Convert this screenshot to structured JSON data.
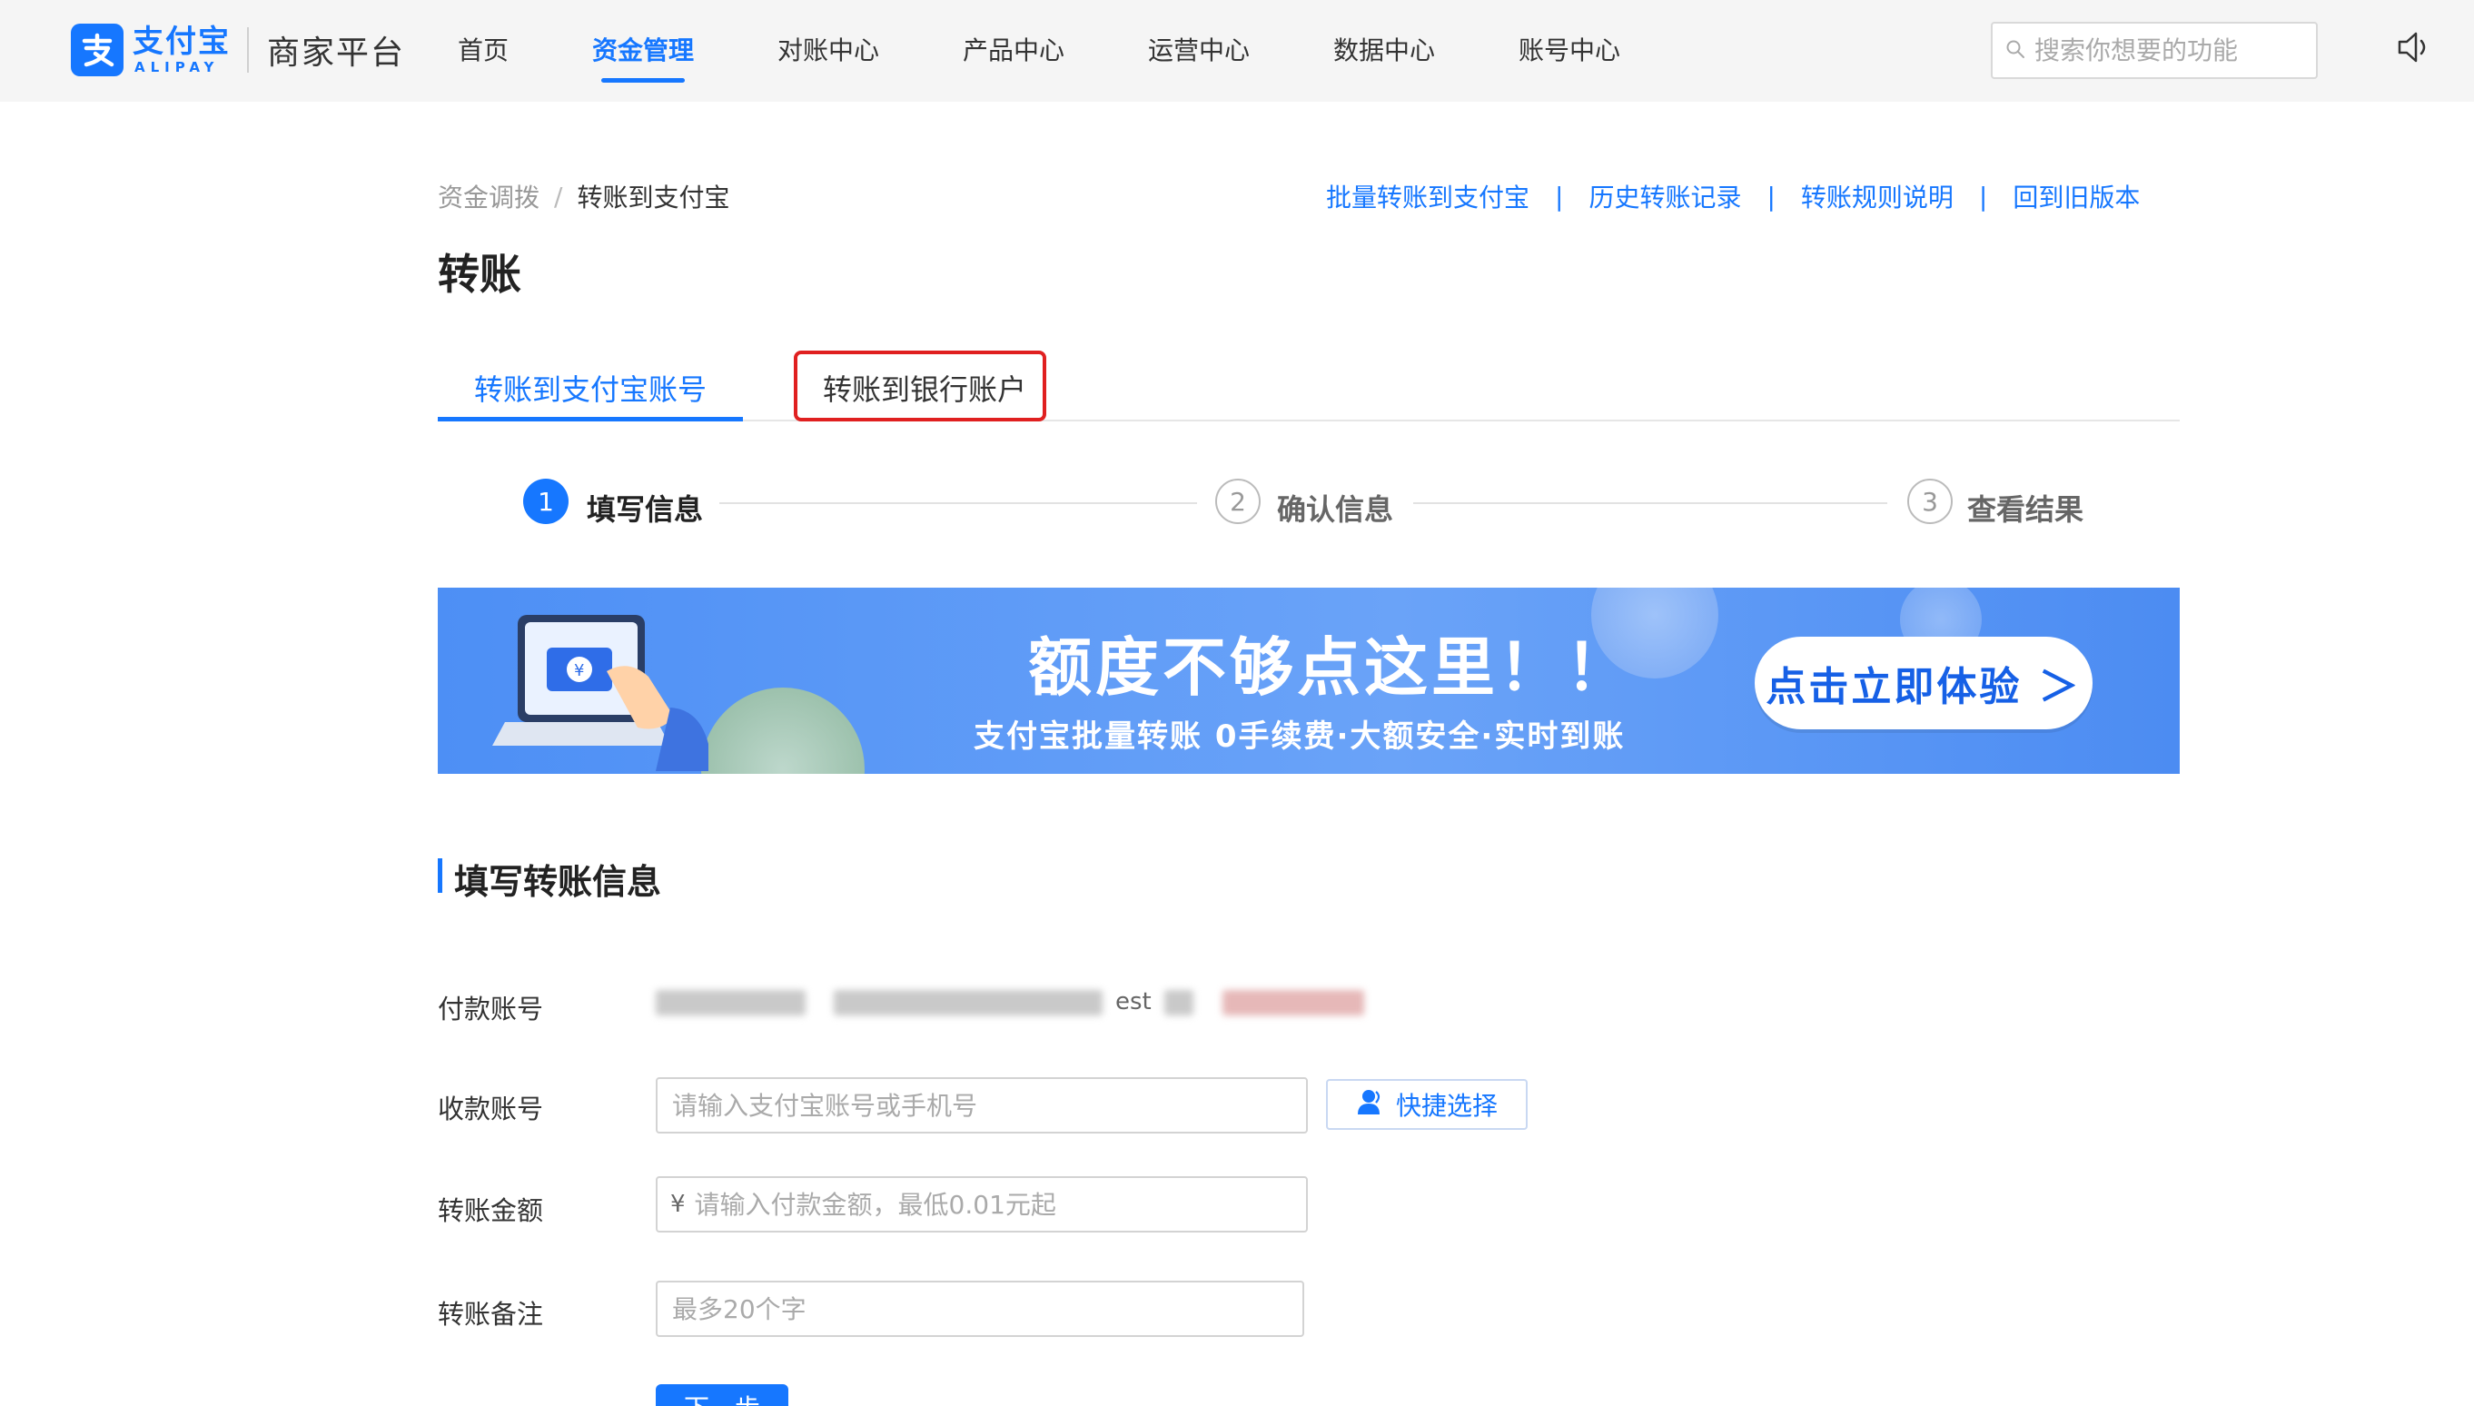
{
  "header": {
    "logo_cn": "支付宝",
    "logo_en": "ALIPAY",
    "product": "商家平台",
    "nav": [
      {
        "label": "首页",
        "active": false
      },
      {
        "label": "资金管理",
        "active": true
      },
      {
        "label": "对账中心",
        "active": false
      },
      {
        "label": "产品中心",
        "active": false
      },
      {
        "label": "运营中心",
        "active": false
      },
      {
        "label": "数据中心",
        "active": false
      },
      {
        "label": "账号中心",
        "active": false
      }
    ],
    "search_placeholder": "搜索你想要的功能",
    "icons": [
      "search-icon",
      "speaker-icon"
    ]
  },
  "breadcrumb": {
    "parent": "资金调拨",
    "separator": "/",
    "current": "转账到支付宝"
  },
  "top_links": [
    "批量转账到支付宝",
    "历史转账记录",
    "转账规则说明",
    "回到旧版本"
  ],
  "page_title": "转账",
  "tabs": [
    {
      "label": "转账到支付宝账号",
      "active": true
    },
    {
      "label": "转账到银行账户",
      "active": false,
      "highlighted": true
    }
  ],
  "steps": [
    {
      "number": "1",
      "label": "填写信息",
      "active": true
    },
    {
      "number": "2",
      "label": "确认信息",
      "active": false
    },
    {
      "number": "3",
      "label": "查看结果",
      "active": false
    }
  ],
  "banner": {
    "headline": "额度不够点这里！！",
    "subline": "支付宝批量转账 0手续费·大额安全·实时到账",
    "cta": "点击立即体验 ＞"
  },
  "form": {
    "section_title": "填写转账信息",
    "payer_label": "付款账号",
    "payer_value_visible": "est",
    "payee_label": "收款账号",
    "payee_placeholder": "请输入支付宝账号或手机号",
    "quick_select_label": "快捷选择",
    "amount_label": "转账金额",
    "amount_prefix": "¥",
    "amount_placeholder": "请输入付款金额，最低0.01元起",
    "remark_label": "转账备注",
    "remark_placeholder": "最多20个字",
    "next_button": "下一步"
  },
  "colors": {
    "primary": "#1677ff",
    "highlight_border": "#e02020",
    "banner_bg": "#5b97f6"
  }
}
